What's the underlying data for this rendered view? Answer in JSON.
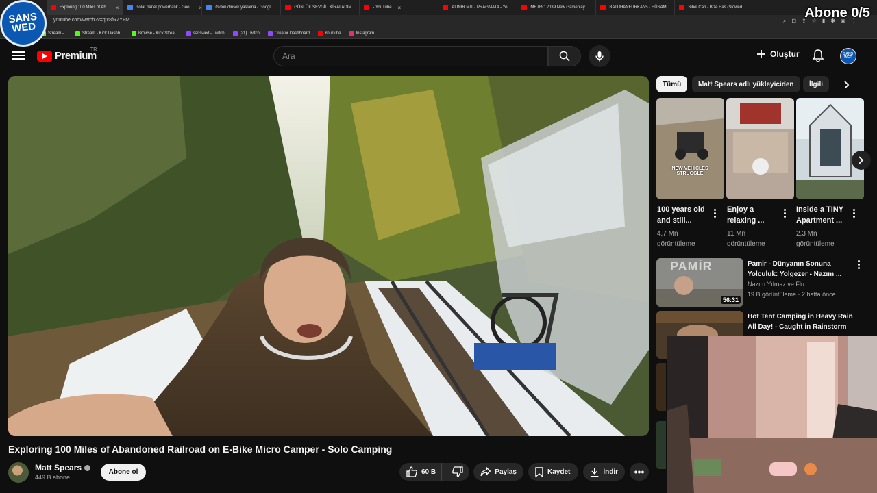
{
  "browser": {
    "tabs": [
      {
        "label": "Exploring 100 Miles of Ab...",
        "color": "#ff0000",
        "active": true
      },
      {
        "label": "solar panel powerbank - Goo...",
        "color": "#4285f4",
        "active": false
      },
      {
        "label": "Gidon dinsek yaslama - Googl...",
        "color": "#4285f4",
        "active": false
      },
      {
        "label": "GÜNLÜK SEVGİLİ KİRALADIM...",
        "color": "#ff0000",
        "active": false
      },
      {
        "label": "- YouTube",
        "color": "#ff0000",
        "active": false
      },
      {
        "label": "ALINIR MIT - PRAGMATA - Yo...",
        "color": "#ff0000",
        "active": false
      },
      {
        "label": "METRO 2039 New Gameplay ...",
        "color": "#ff0000",
        "active": false
      },
      {
        "label": "BATUHANFURKAN5 - HÜSAM...",
        "color": "#ff0000",
        "active": false
      },
      {
        "label": "Sibel Can - Bize Has (Slowed...",
        "color": "#ff0000",
        "active": false
      }
    ],
    "url": "youtube.com/watch?v=qtc8fRZYFM",
    "bookmarks": [
      {
        "label": "Stream -...",
        "color": "#53fc18"
      },
      {
        "label": "Stream - Kick Dashb...",
        "color": "#53fc18"
      },
      {
        "label": "Browse - Kick Strea...",
        "color": "#53fc18"
      },
      {
        "label": "sanswed - Twitch",
        "color": "#9146ff"
      },
      {
        "label": "(21) Twitch",
        "color": "#9146ff"
      },
      {
        "label": "Creator Dashboard",
        "color": "#9146ff"
      },
      {
        "label": "YouTube",
        "color": "#ff0000"
      },
      {
        "label": "Instagram",
        "color": "#e1306c"
      }
    ]
  },
  "overlay": {
    "logo_text": "SANS WED",
    "abone_counter": "Abone 0/5"
  },
  "header": {
    "logo_word": "Premium",
    "region": "TR",
    "search_placeholder": "Ara",
    "create_label": "Oluştur",
    "avatar_text": "SANS WED"
  },
  "video": {
    "title": "Exploring 100 Miles of Abandoned Railroad on E-Bike Micro Camper - Solo Camping",
    "channel": "Matt Spears",
    "subscribers": "449 B abone",
    "subscribe_label": "Abone ol",
    "likes": "60 B",
    "share_label": "Paylaş",
    "save_label": "Kaydet",
    "download_label": "İndir"
  },
  "sidebar": {
    "chips": [
      "Tümü",
      "Matt Spears adlı yükleyiciden",
      "İlgili"
    ],
    "shorts": [
      {
        "title": "100 years old and still...",
        "views": "4,7 Mn görüntüleme",
        "overlay": "NEW VEHICLES STRUGGLE"
      },
      {
        "title": "Enjoy a relaxing ...",
        "views": "11 Mn görüntüleme"
      },
      {
        "title": "Inside a TINY Apartment ...",
        "views": "2,3 Mn görüntüleme"
      }
    ],
    "recommendations": [
      {
        "title": "Pamir - Dünyanın Sonuna Yolculuk: Yolgezer - Nazım ...",
        "channel": "Nazım Yılmaz ve Flu",
        "meta": "19 B görüntüleme · 2 hafta önce",
        "duration": "56:31",
        "thumb_text": "PAMİR"
      },
      {
        "title": "Hot Tent Camping in Heavy Rain All Day! - Caught in Rainstorm ..."
      }
    ]
  }
}
